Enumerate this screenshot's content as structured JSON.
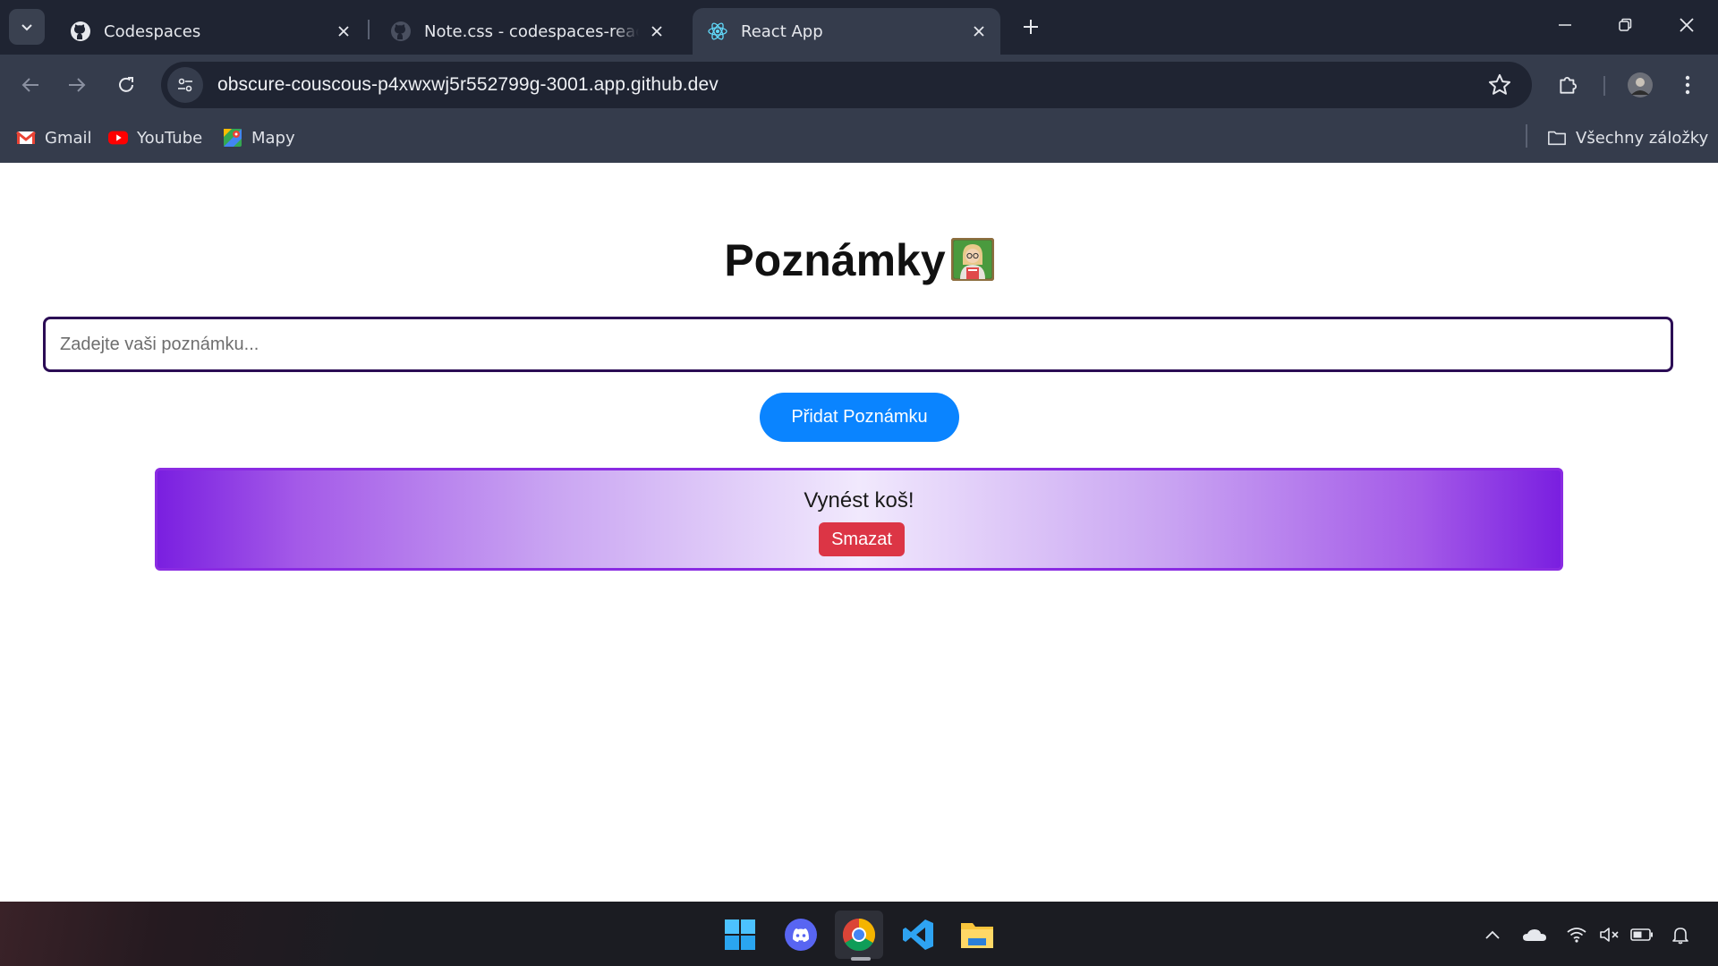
{
  "browser": {
    "tabs": [
      {
        "title": "Codespaces",
        "icon": "github-icon",
        "active": false
      },
      {
        "title": "Note.css - codespaces-react [Codespaces]",
        "icon": "github-icon",
        "active": false
      },
      {
        "title": "React App",
        "icon": "react-icon",
        "active": true
      }
    ],
    "url": "obscure-couscous-p4xwxwj5r552799g-3001.app.github.dev",
    "bookmarks": [
      {
        "label": "Gmail",
        "icon": "gmail-icon"
      },
      {
        "label": "YouTube",
        "icon": "youtube-icon"
      },
      {
        "label": "Mapy",
        "icon": "maps-icon"
      }
    ],
    "all_bookmarks_label": "Všechny záložky"
  },
  "page": {
    "title": "Poznámky",
    "title_emoji": "teacher-emoji",
    "input_placeholder": "Zadejte vaši poznámku...",
    "input_value": "",
    "add_button_label": "Přidat Poznámku",
    "notes": [
      {
        "text": "Vynést koš!",
        "delete_label": "Smazat"
      }
    ]
  },
  "taskbar": {
    "apps": [
      "windows-start-icon",
      "discord-icon",
      "chrome-icon",
      "vscode-icon",
      "file-explorer-icon"
    ],
    "active_app": "chrome-icon",
    "tray": [
      "chevron-up-icon",
      "onedrive-icon",
      "wifi-icon",
      "volume-muted-icon",
      "battery-icon",
      "notification-bell-icon"
    ]
  },
  "colors": {
    "chrome_dark": "#1f2432",
    "chrome_toolbar": "#353c4c",
    "input_border": "#2b0c55",
    "add_button": "#0a84ff",
    "note_gradient_edge": "#7a1fe0",
    "note_gradient_center": "#f1e9fd",
    "delete_button": "#dc3545"
  }
}
